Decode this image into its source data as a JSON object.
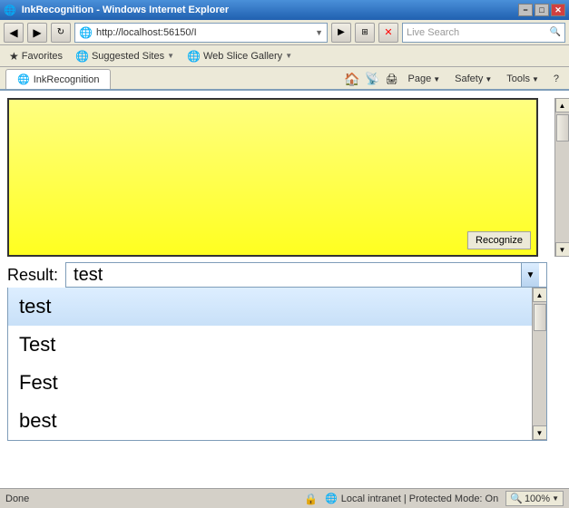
{
  "titleBar": {
    "title": "InkRecognition - Windows Internet Explorer",
    "icon": "🌐",
    "buttons": [
      "−",
      "□",
      "✕"
    ]
  },
  "addressBar": {
    "url": "http://localhost:56150/I",
    "icon": "🌐",
    "searchPlaceholder": "Live Search",
    "searchLabel": "Search"
  },
  "favoritesBar": {
    "favorites": "Favorites",
    "suggestedSites": "Suggested Sites",
    "webSliceGallery": "Web Slice Gallery"
  },
  "tab": {
    "label": "InkRecognition",
    "icon": "🌐"
  },
  "toolbar": {
    "home": "Page",
    "safety": "Safety",
    "tools": "Tools",
    "help": "?"
  },
  "canvas": {
    "recognizeButton": "Recognize"
  },
  "result": {
    "label": "Result:",
    "selectedValue": "test",
    "items": [
      "test",
      "Test",
      "Fest",
      "best"
    ]
  },
  "statusBar": {
    "status": "Done",
    "zone": "Local intranet | Protected Mode: On",
    "zoom": "100%"
  }
}
